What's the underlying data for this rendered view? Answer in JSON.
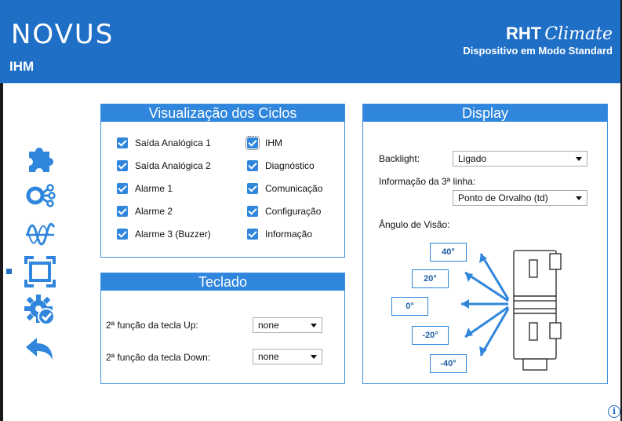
{
  "header": {
    "logo": "NOVUS",
    "page_title": "IHM",
    "product_name": "RHT",
    "product_suffix": "Climate",
    "mode": "Dispositivo em Modo Standard"
  },
  "sidebar": {
    "items": [
      {
        "icon": "puzzle-icon"
      },
      {
        "icon": "network-nodes-icon"
      },
      {
        "icon": "waveform-icon"
      },
      {
        "icon": "display-frame-icon",
        "selected": true
      },
      {
        "icon": "settings-check-icon"
      },
      {
        "icon": "back-arrow-icon"
      }
    ]
  },
  "cycles_panel": {
    "title": "Visualização dos Ciclos",
    "left_items": [
      {
        "label": "Saída Analógica 1",
        "checked": true
      },
      {
        "label": "Saída Analógica 2",
        "checked": true
      },
      {
        "label": "Alarme 1",
        "checked": true
      },
      {
        "label": "Alarme 2",
        "checked": true
      },
      {
        "label": "Alarme 3 (Buzzer)",
        "checked": true
      }
    ],
    "right_items": [
      {
        "label": "IHM",
        "checked": true
      },
      {
        "label": "Diagnóstico",
        "checked": true
      },
      {
        "label": "Comunicação",
        "checked": true
      },
      {
        "label": "Configuração",
        "checked": true
      },
      {
        "label": "Informação",
        "checked": true
      }
    ]
  },
  "keypad_panel": {
    "title": "Teclado",
    "up_label": "2ª função da tecla Up:",
    "up_value": "none",
    "down_label": "2ª função da tecla Down:",
    "down_value": "none"
  },
  "display_panel": {
    "title": "Display",
    "backlight_label": "Backlight:",
    "backlight_value": "Ligado",
    "line3_label": "Informação da 3ª linha:",
    "line3_value": "Ponto de Orvalho (td)",
    "angle_label": "Ângulo de Visão:",
    "angles": [
      "40°",
      "20°",
      "0°",
      "-20°",
      "-40°"
    ]
  },
  "colors": {
    "brand": "#1f6fc6",
    "panel_title": "#2f86dc",
    "arrow": "#2f86dc"
  }
}
